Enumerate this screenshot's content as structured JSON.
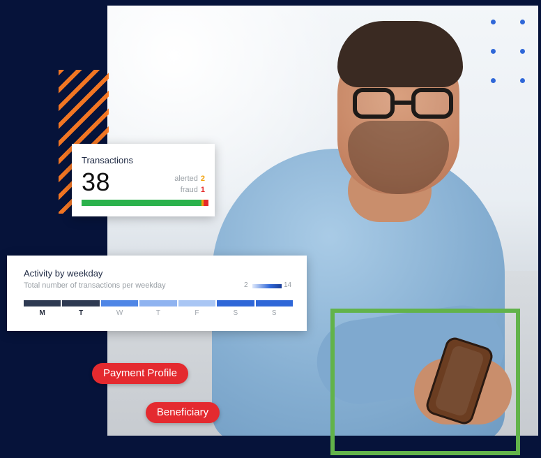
{
  "transactions_card": {
    "title": "Transactions",
    "value": "38",
    "alerted_label": "alerted",
    "alerted_count": "2",
    "fraud_label": "fraud",
    "fraud_count": "1",
    "colors": {
      "ok": "#2bb24c",
      "alerted": "#f2a10a",
      "fraud": "#e52a2a"
    }
  },
  "activity_card": {
    "title": "Activity by weekday",
    "subtitle": "Total number of transactions per weekday",
    "legend_min": "2",
    "legend_max": "14",
    "days": [
      {
        "label": "M",
        "color": "#2e3a52",
        "strong": true
      },
      {
        "label": "T",
        "color": "#2e3a52",
        "strong": true
      },
      {
        "label": "W",
        "color": "#4f86e6",
        "strong": false
      },
      {
        "label": "T",
        "color": "#8fb3f0",
        "strong": false
      },
      {
        "label": "F",
        "color": "#a9c6f4",
        "strong": false
      },
      {
        "label": "S",
        "color": "#2f67d8",
        "strong": false
      },
      {
        "label": "S",
        "color": "#2f67d8",
        "strong": false
      }
    ]
  },
  "tags": {
    "payment_profile": "Payment Profile",
    "beneficiary": "Beneficiary"
  }
}
